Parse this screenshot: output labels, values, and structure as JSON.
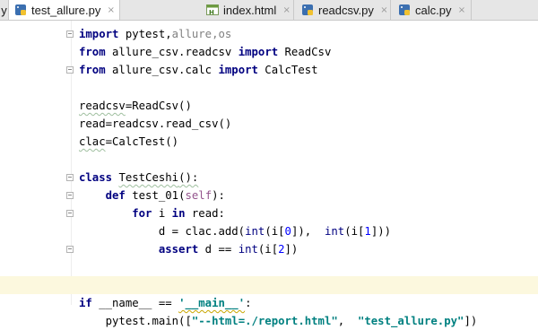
{
  "tabs": [
    {
      "label": "test_allure.py",
      "icon": "python-file-icon",
      "active": true
    },
    {
      "label": "index.html",
      "icon": "html-file-icon",
      "active": false
    },
    {
      "label": "readcsv.py",
      "icon": "python-file-icon",
      "active": false
    },
    {
      "label": "calc.py",
      "icon": "python-file-icon",
      "active": false
    }
  ],
  "close_glyph": "×",
  "partial_tab_glyph": "y",
  "code": {
    "l1": {
      "kw": "import",
      "a": " pytest",
      "b": ",",
      "c": "allure",
      "d": ",",
      "e": "os"
    },
    "l2": {
      "kw1": "from",
      "a": " allure_csv.readcsv ",
      "kw2": "import",
      "b": " ReadCsv"
    },
    "l3": {
      "kw1": "from",
      "a": " allure_csv.calc ",
      "kw2": "import",
      "b": " CalcTest"
    },
    "l5": {
      "a": "readcsv",
      "b": "=ReadCsv()"
    },
    "l6": {
      "a": "read=readcsv.read_csv()"
    },
    "l7": {
      "a": "clac",
      "b": "=CalcTest()"
    },
    "l9": {
      "kw": "class",
      "a": " ",
      "b": "TestCeshi",
      "c": "():"
    },
    "l10": {
      "ind": "    ",
      "kw": "def",
      "a": " test_01(",
      "self": "self",
      "b": "):"
    },
    "l11": {
      "ind": "        ",
      "kw1": "for",
      "a": " i ",
      "kw2": "in",
      "b": " read:"
    },
    "l12": {
      "ind": "            ",
      "a": "d = clac.add(",
      "bi1": "int",
      "b": "(i[",
      "n1": "0",
      "c": "]),  ",
      "bi2": "int",
      "d": "(i[",
      "n2": "1",
      "e": "]))"
    },
    "l13": {
      "ind": "            ",
      "kw": "assert",
      "a": " d == ",
      "bi": "int",
      "b": "(i[",
      "n": "2",
      "c": "])"
    },
    "l15": {
      "kw": "if",
      "a": " __name__ == ",
      "s": "'__main__'",
      "b": ":"
    },
    "l16": {
      "ind": "    ",
      "a": "pytest.main([",
      "s1": "\"--html=./report.html\"",
      "b": ",  ",
      "s2": "\"test_allure.py\"",
      "c": "])"
    }
  }
}
